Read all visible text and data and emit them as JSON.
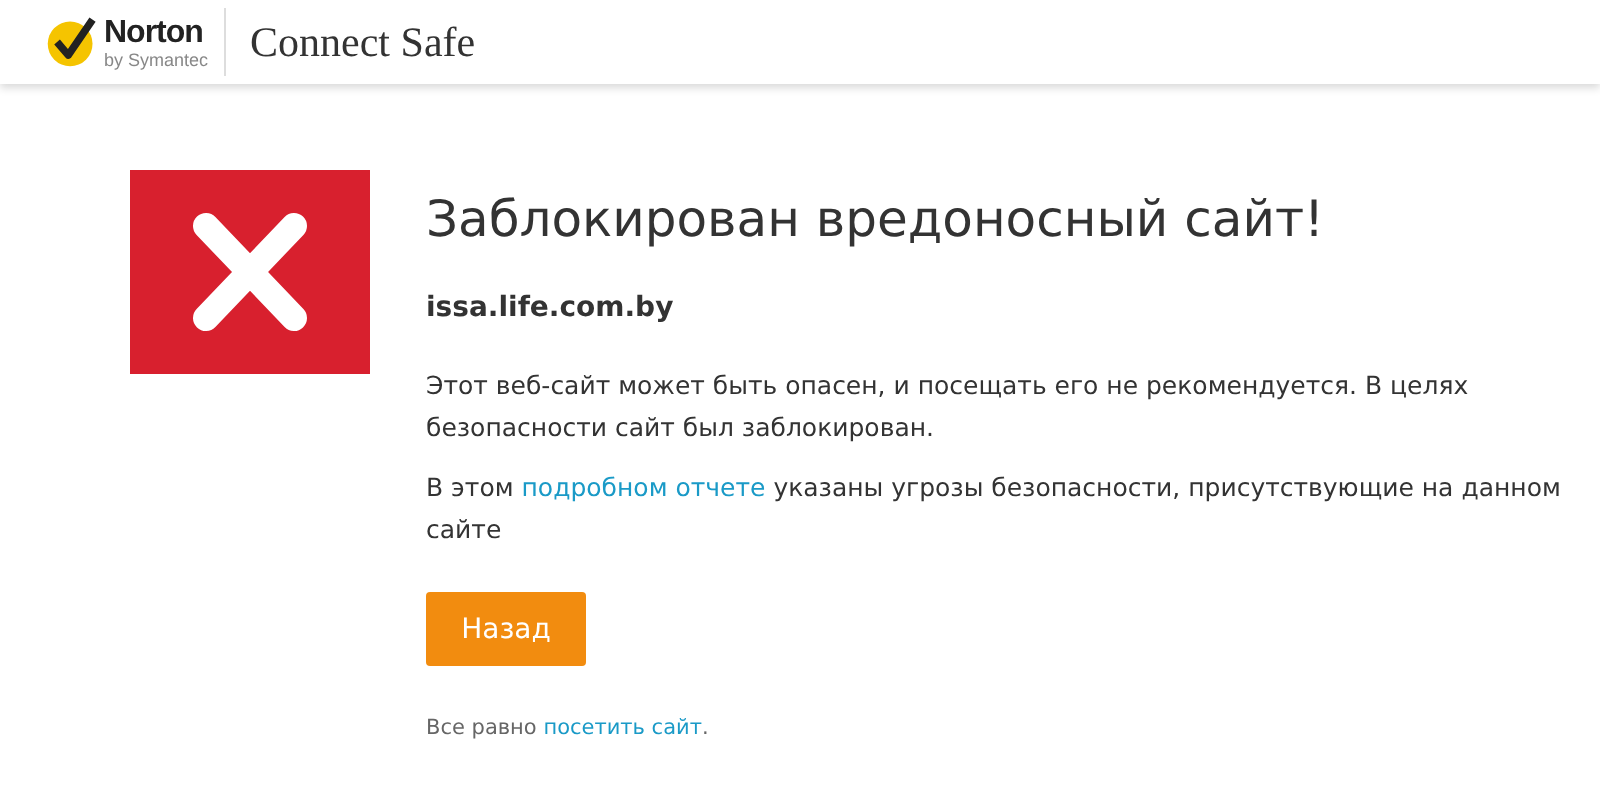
{
  "header": {
    "brand": "Norton",
    "brand_sub": "by Symantec",
    "product": "Connect Safe"
  },
  "warning": {
    "title": "Заблокирован вредоносный сайт!",
    "domain": "issa.life.com.by",
    "paragraph": "Этот веб-сайт может быть опасен, и посещать его не рекомендуется. В целях безопасности сайт был заблокирован.",
    "report": {
      "before": "В этом ",
      "link": "подробном отчете",
      "after": " указаны угрозы безопасности, присутствующие на данном сайте"
    },
    "button": "Назад",
    "footer": {
      "before": "Все равно ",
      "link": "посетить сайт",
      "after": "."
    }
  }
}
